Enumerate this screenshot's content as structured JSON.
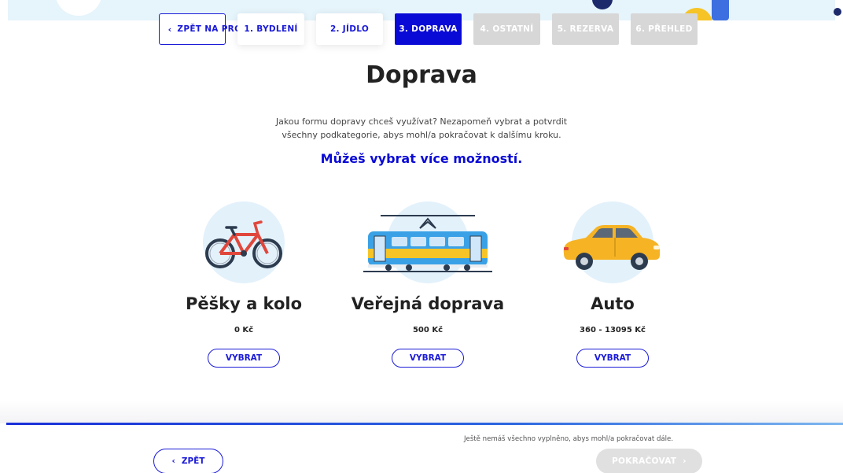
{
  "nav": {
    "back_label": "ZPĚT NA PROFESI",
    "back_arrow": "‹",
    "steps": [
      {
        "label": "1. BYDLENÍ",
        "state": "done"
      },
      {
        "label": "2. JÍDLO",
        "state": "done"
      },
      {
        "label": "3. DOPRAVA",
        "state": "current"
      },
      {
        "label": "4. OSTATNÍ",
        "state": "disabled"
      },
      {
        "label": "5. REZERVA",
        "state": "disabled"
      },
      {
        "label": "6. PŘEHLED",
        "state": "disabled"
      }
    ]
  },
  "page": {
    "title": "Doprava",
    "description": "Jakou formu dopravy chceš využívat? Nezapomeň vybrat a potvrdit všechny podkategorie, abys mohl/a pokračovat k dalšímu kroku.",
    "highlight": "Můžeš vybrat více možností."
  },
  "options": [
    {
      "icon": "bicycle-icon",
      "name": "Pěšky a kolo",
      "price": "0 Kč",
      "button": "VYBRAT"
    },
    {
      "icon": "tram-icon",
      "name": "Veřejná doprava",
      "price": "500 Kč",
      "button": "VYBRAT"
    },
    {
      "icon": "car-icon",
      "name": "Auto",
      "price": "360 - 13095 Kč",
      "button": "VYBRAT"
    }
  ],
  "footer": {
    "note": "Ještě nemáš všechno vyplněno, abys mohl/a pokračovat dále.",
    "back_label": "ZPĚT",
    "back_arrow": "‹",
    "next_label": "POKRAČOVAT",
    "next_arrow": "›"
  },
  "colors": {
    "accent": "#0a0ad6",
    "disabled": "#d7d7d7",
    "icon_bg": "#e3f1fb",
    "bicycle": "#e0473c",
    "tram": "#3aa1e6",
    "car": "#f6b324"
  }
}
